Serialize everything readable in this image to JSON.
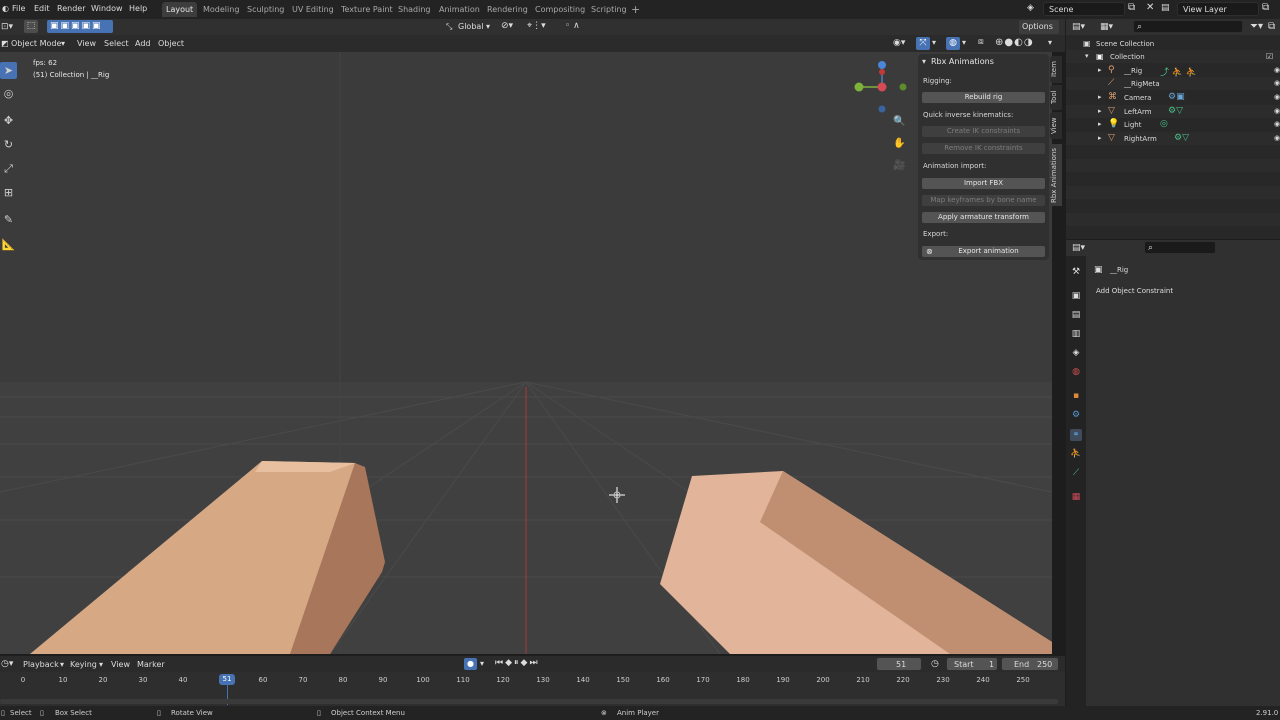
{
  "topbar": {
    "menus": [
      "File",
      "Edit",
      "Render",
      "Window",
      "Help"
    ],
    "workspaces": [
      "Layout",
      "Modeling",
      "Sculpting",
      "UV Editing",
      "Texture Paint",
      "Shading",
      "Animation",
      "Rendering",
      "Compositing",
      "Scripting"
    ],
    "active_workspace": "Layout",
    "add_tab": "+",
    "scene": "Scene",
    "view_layer": "View Layer"
  },
  "viewport_header": {
    "orientation": "Global",
    "options": "Options",
    "mode": "Object Mode",
    "menus": [
      "View",
      "Select",
      "Add",
      "Object"
    ]
  },
  "overlay": {
    "fps": "fps: 62",
    "collection": "(51) Collection | __Rig"
  },
  "npanel": {
    "title": "Rbx Animations",
    "rigging_label": "Rigging:",
    "rebuild_rig": "Rebuild rig",
    "qik_label": "Quick inverse kinematics:",
    "create_ik": "Create IK constraints",
    "remove_ik": "Remove IK constraints",
    "anim_import_label": "Animation import:",
    "import_fbx": "Import FBX",
    "map_keyframes": "Map keyframes by bone name",
    "apply_armature": "Apply armature transform",
    "export_label": "Export:",
    "export_animation": "Export animation",
    "tabs": [
      "Item",
      "Tool",
      "View",
      "Rbx Animations"
    ]
  },
  "outliner": {
    "scene_collection": "Scene Collection",
    "collection": "Collection",
    "items": [
      {
        "name": "__Rig",
        "icon_color": "#e0a070"
      },
      {
        "name": "__RigMeta",
        "icon_color": "#e0a070"
      },
      {
        "name": "Camera",
        "icon_color": "#e0a070"
      },
      {
        "name": "LeftArm",
        "icon_color": "#e0a070"
      },
      {
        "name": "Light",
        "icon_color": "#e0a070"
      },
      {
        "name": "RightArm",
        "icon_color": "#e0a070"
      }
    ]
  },
  "properties": {
    "object_name": "__Rig",
    "add_constraint": "Add Object Constraint"
  },
  "timeline": {
    "menus": [
      "Playback",
      "Keying",
      "View",
      "Marker"
    ],
    "current_frame": "51",
    "start_label": "Start",
    "start": "1",
    "end_label": "End",
    "end": "250",
    "ticks": [
      "0",
      "10",
      "20",
      "30",
      "40",
      "60",
      "70",
      "80",
      "90",
      "100",
      "110",
      "120",
      "130",
      "140",
      "150",
      "160",
      "170",
      "180",
      "190",
      "200",
      "210",
      "220",
      "230",
      "240",
      "250"
    ],
    "playhead": "51"
  },
  "statusbar": {
    "select": "Select",
    "box_select": "Box Select",
    "rotate_view": "Rotate View",
    "context_menu": "Object Context Menu",
    "anim_player": "Anim Player",
    "version": "2.91.0"
  },
  "colors": {
    "accent": "#4772b3",
    "arm_light": "#e2b08c",
    "arm_dark": "#a8765a",
    "axis_red": "#a83a3a"
  }
}
